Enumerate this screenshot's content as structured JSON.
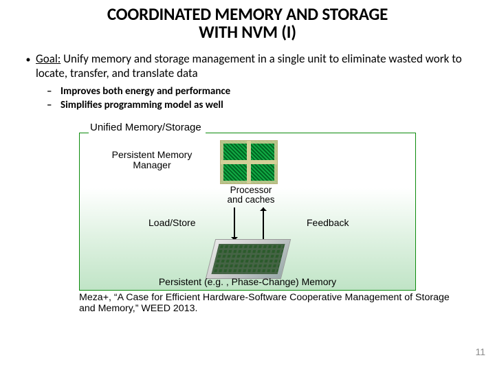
{
  "title_l1": "COORDINATED MEMORY AND STORAGE",
  "title_l2": "WITH NVM (I)",
  "bullet": {
    "prefix": "Goal:",
    "rest": " Unify memory and storage management in a single unit to eliminate wasted work to locate, transfer, and translate data"
  },
  "subs": [
    "Improves both energy and performance",
    "Simplifies programming model as well"
  ],
  "fig": {
    "title": "Unified Memory/Storage",
    "pmm_l1": "Persistent Memory",
    "pmm_l2": "Manager",
    "proc_l1": "Processor",
    "proc_l2": "and caches",
    "loadstore": "Load/Store",
    "feedback": "Feedback",
    "persistent": "Persistent (e.g. , Phase-Change) Memory"
  },
  "cite": "Meza+, “A Case for Efficient Hardware-Software Cooperative Management of Storage and Memory,” WEED 2013.",
  "page": "11"
}
